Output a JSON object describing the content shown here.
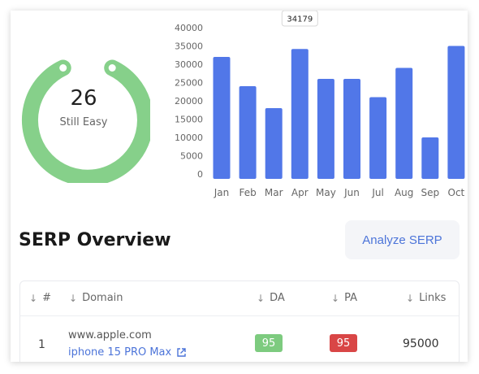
{
  "gauge": {
    "value": "26",
    "label": "Still Easy",
    "color": "#86d08a"
  },
  "chart_data": {
    "type": "bar",
    "categories": [
      "Jan",
      "Feb",
      "Mar",
      "Apr",
      "May",
      "Jun",
      "Jul",
      "Aug",
      "Sep",
      "Oct"
    ],
    "values": [
      32000,
      24000,
      18000,
      34179,
      26000,
      26000,
      21000,
      29000,
      10000,
      35000
    ],
    "ylim": [
      0,
      40000
    ],
    "yticks": [
      0,
      5000,
      10000,
      15000,
      20000,
      25000,
      30000,
      35000,
      40000
    ],
    "ytick_labels": [
      "0",
      "5000",
      "10000",
      "15000",
      "20000",
      "25000",
      "30000",
      "35000",
      "40000"
    ],
    "tooltip": {
      "category": "Apr",
      "text": "34179"
    },
    "bar_color": "#5177e8"
  },
  "serp": {
    "title": "SERP Overview",
    "analyze_label": "Analyze SERP",
    "columns": [
      "#",
      "Domain",
      "DA",
      "PA",
      "Links"
    ],
    "rows": [
      {
        "num": "1",
        "domain": "www.apple.com",
        "keyword": "iphone 15 PRO Max",
        "da": "95",
        "pa": "95",
        "links": "95000"
      }
    ],
    "da_color": "#7dcb7f",
    "pa_color": "#d94646"
  }
}
